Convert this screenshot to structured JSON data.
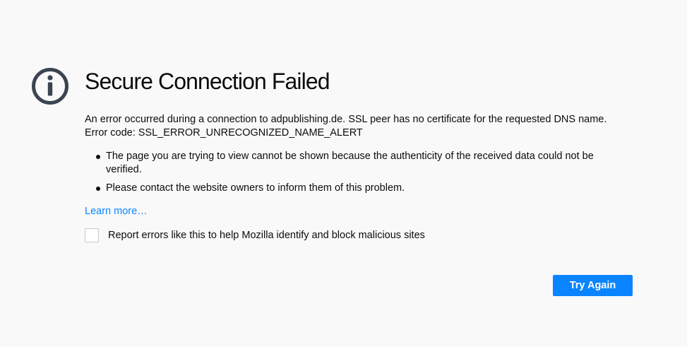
{
  "error_page": {
    "title": "Secure Connection Failed",
    "description": "An error occurred during a connection to adpublishing.de. SSL peer has no certificate for the requested DNS name. Error code: SSL_ERROR_UNRECOGNIZED_NAME_ALERT",
    "bullets": [
      "The page you are trying to view cannot be shown because the authenticity of the received data could not be verified.",
      "Please contact the website owners to inform them of this problem."
    ],
    "learn_more": "Learn more…",
    "report_label": "Report errors like this to help Mozilla identify and block malicious sites",
    "try_again_label": "Try Again",
    "icon": "info-icon"
  },
  "colors": {
    "background": "#f9f9fa",
    "accent": "#0a84ff",
    "icon": "#3b4450"
  }
}
